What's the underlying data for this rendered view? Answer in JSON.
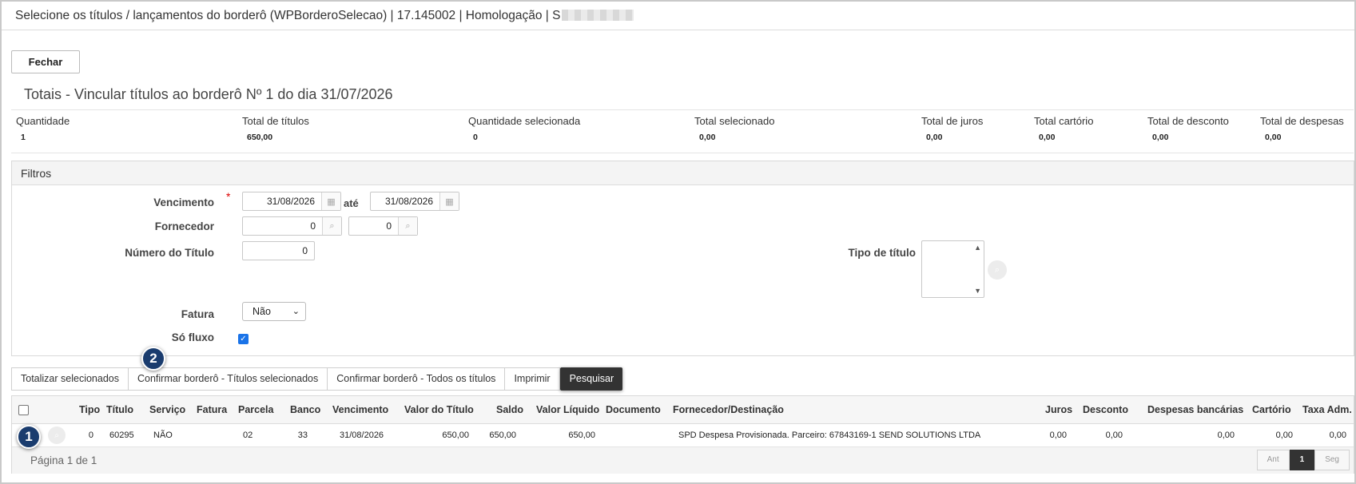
{
  "window": {
    "title": "Selecione os títulos / lançamentos do borderô (WPBorderoSelecao) | 17.145002 | Homologação | S"
  },
  "actions": {
    "close_label": "Fechar"
  },
  "totals": {
    "title": "Totais - Vincular títulos ao borderô Nº 1 do dia 31/07/2026",
    "items": [
      {
        "label": "Quantidade",
        "value": "1"
      },
      {
        "label": "Total de títulos",
        "value": "650,00"
      },
      {
        "label": "Quantidade selecionada",
        "value": "0"
      },
      {
        "label": "Total selecionado",
        "value": "0,00"
      },
      {
        "label": "Total de juros",
        "value": "0,00"
      },
      {
        "label": "Total cartório",
        "value": "0,00"
      },
      {
        "label": "Total de desconto",
        "value": "0,00"
      },
      {
        "label": "Total de despesas",
        "value": "0,00"
      }
    ]
  },
  "filters": {
    "header": "Filtros",
    "vencimento": {
      "label": "Vencimento",
      "required_mark": "*",
      "from": "31/08/2026",
      "to_label": "até",
      "to": "31/08/2026"
    },
    "fornecedor": {
      "label": "Fornecedor",
      "from": "0",
      "to": "0"
    },
    "numero_titulo": {
      "label": "Número do Título",
      "value": "0"
    },
    "tipo_titulo": {
      "label": "Tipo de título"
    },
    "fatura": {
      "label": "Fatura",
      "selected": "Não"
    },
    "so_fluxo": {
      "label": "Só fluxo",
      "checked": true
    }
  },
  "toolbar": {
    "buttons": [
      "Totalizar selecionados",
      "Confirmar borderô - Títulos selecionados",
      "Confirmar borderô - Todos os títulos",
      "Imprimir",
      "Pesquisar"
    ]
  },
  "grid": {
    "columns": [
      "Tipo",
      "Título",
      "Serviço",
      "Fatura",
      "Parcela",
      "Banco",
      "Vencimento",
      "Valor do Título",
      "Saldo",
      "Valor Líquido",
      "Documento",
      "Fornecedor/Destinação",
      "Juros",
      "Desconto",
      "Despesas bancárias",
      "Cartório",
      "Taxa Adm."
    ],
    "rows": [
      {
        "tipo": "0",
        "titulo": "60295",
        "servico": "NÃO",
        "fatura": "",
        "parcela": "02",
        "banco": "33",
        "vencimento": "31/08/2026",
        "valor_titulo": "650,00",
        "saldo": "650,00",
        "valor_liquido": "650,00",
        "documento": "",
        "fornecedor": "SPD Despesa Provisionada. Parceiro: 67843169-1 SEND SOLUTIONS LTDA",
        "juros": "0,00",
        "desconto": "0,00",
        "despesas_bancarias": "0,00",
        "cartorio": "0,00",
        "taxa_adm": "0,00"
      }
    ],
    "footer": {
      "page_info": "Página 1 de 1",
      "prev_label": "Ant",
      "current_page": "1",
      "next_label": "Seg"
    }
  },
  "annotations": [
    "1",
    "2"
  ],
  "colors": {
    "primary_dark": "#333333",
    "badge": "#1a3c6e",
    "required": "#dd0000",
    "checkbox": "#1a73e8"
  }
}
